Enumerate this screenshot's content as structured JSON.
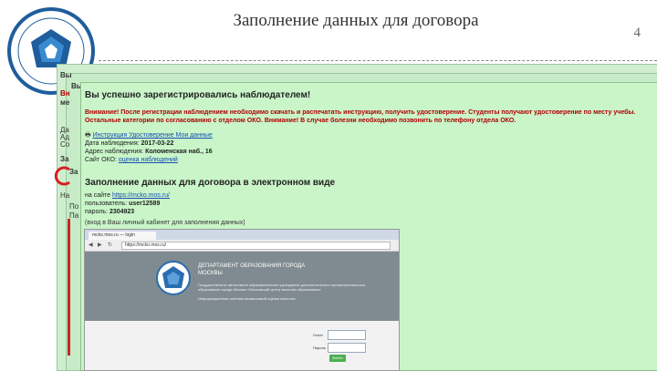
{
  "slide": {
    "title": "Заполнение данных для договора",
    "number": "4"
  },
  "background_windows": {
    "labels": [
      "Вы",
      "Вы",
      "Вн",
      "ме",
      "Да",
      "Ад",
      "Со",
      "За",
      "За",
      "На",
      "По",
      "Па"
    ]
  },
  "front_window": {
    "header": "Вы успешно зарегистрировались наблюдателем!",
    "notice": "Внимание! После регистрации наблюдением необходимо скачать и распечатать инструкцию, получить удостоверение. Студенты получают удостоверение по месту учебы. Остальные категории по согласованию с отделом ОКО. Внимание! В случае болезни необходимо позвонить по телефону отдела ОКО.",
    "links_line": "Инструкция  Удостоверение  Мои данные",
    "date_label": "Дата наблюдения:",
    "date_value": "2017-03-22",
    "address_label": "Адрес наблюдения:",
    "address_value": "Коломенская наб., 16",
    "site_label": "Сайт ОКО:",
    "site_value": "оценка наблюдений",
    "section_title": "Заполнение данных для договора в электронном виде",
    "on_site": "на сайте",
    "url": "https://mcko.mos.ru/",
    "login_label": "пользователь:",
    "login_value": "user12589",
    "password_label": "пароль:",
    "password_value": "2304923",
    "footnote": "(вход в Ваш личный кабинет для заполнения данных)"
  },
  "browser": {
    "tab_label": "mcko.mos.ru — login",
    "url": "https://mcko.mos.ru/",
    "department_title": "ДЕПАРТАМЕНТ ОБРАЗОВАНИЯ ГОРОДА МОСКВЫ",
    "department_sub": "Государственное автономное образовательное учреждение дополнительного профессионального образования города Москвы «Московский центр качества образования»",
    "department_sub2": "Информационная система независимой оценки качества",
    "login_label": "Логин",
    "password_label": "Пароль",
    "submit_label": "Войти"
  }
}
